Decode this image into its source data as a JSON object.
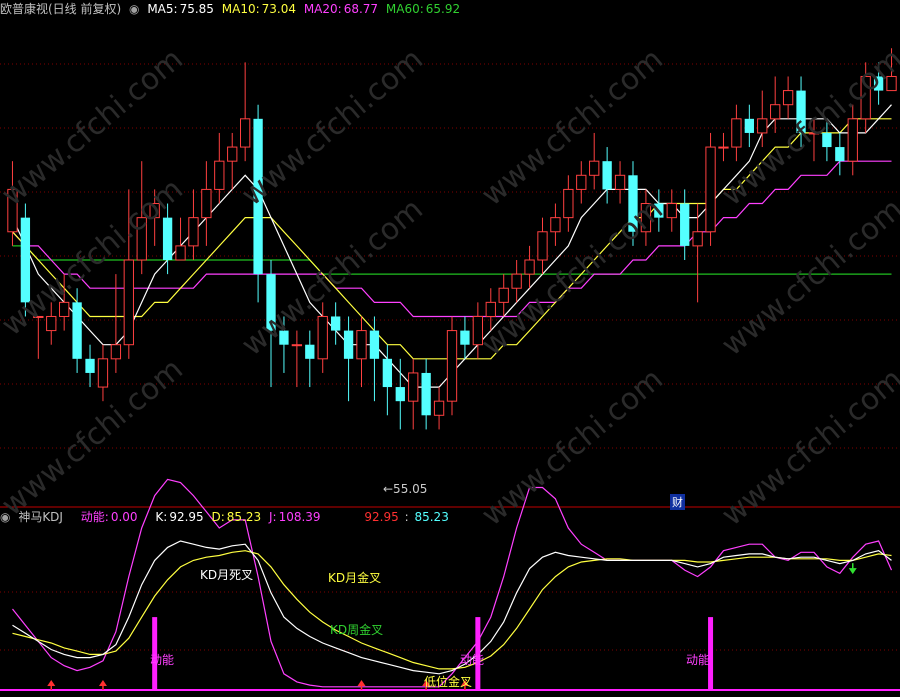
{
  "top_header": {
    "title": "欧普康视(日线 前复权)",
    "ma5_label": "MA5:",
    "ma5_value": "75.85",
    "ma10_label": "MA10:",
    "ma10_value": "73.04",
    "ma20_label": "MA20:",
    "ma20_value": "68.77",
    "ma60_label": "MA60:",
    "ma60_value": "65.92"
  },
  "bottom_header": {
    "title": "神马KDJ",
    "dn_label": "动能:",
    "dn_value": "0.00",
    "k_label": "K:",
    "k_value": "92.95",
    "d_label": "D:",
    "d_value": "85.23",
    "j_label": "J:",
    "j_value": "108.39",
    "v1": "92.95",
    "v2": "85.23"
  },
  "low_marker": "←55.05",
  "cai_badge": "财",
  "annotations": {
    "kd_month_dead": "KD月死叉",
    "kd_month_gold": "KD月金叉",
    "kd_week_gold": "KD周金叉",
    "low_gold": "低位金叉",
    "dongneng1": "动能",
    "dongneng2": "动能",
    "dongneng3": "动能"
  },
  "watermark": "www.cfchi.com",
  "colors": {
    "up": "#ff4040",
    "down": "#54ffff",
    "ma5": "#ffffff",
    "ma10": "#ffff40",
    "ma20": "#ff40ff",
    "ma60": "#20c020",
    "grid": "#800000"
  },
  "chart_data": {
    "type": "candlestick",
    "price_ylim": [
      50,
      84
    ],
    "candles": [
      [
        69,
        72,
        74,
        68
      ],
      [
        70,
        64,
        71,
        63
      ],
      [
        63,
        63,
        63,
        60
      ],
      [
        62,
        63,
        64,
        61
      ],
      [
        63,
        64,
        66,
        62
      ],
      [
        64,
        60,
        65,
        59
      ],
      [
        60,
        59,
        61,
        58
      ],
      [
        58,
        60,
        61,
        57
      ],
      [
        60,
        61,
        66,
        59
      ],
      [
        61,
        67,
        72,
        60
      ],
      [
        67,
        70,
        74,
        66
      ],
      [
        70,
        71,
        72,
        68
      ],
      [
        70,
        67,
        71,
        66
      ],
      [
        67,
        68,
        70,
        67
      ],
      [
        68,
        70,
        72,
        67
      ],
      [
        70,
        72,
        74,
        68
      ],
      [
        72,
        74,
        76,
        71
      ],
      [
        74,
        75,
        76,
        72
      ],
      [
        75,
        77,
        81,
        74
      ],
      [
        77,
        66,
        78,
        64
      ],
      [
        66,
        62,
        67,
        58
      ],
      [
        62,
        61,
        63,
        59
      ],
      [
        61,
        61,
        62,
        58
      ],
      [
        61,
        60,
        62,
        58
      ],
      [
        60,
        63,
        64,
        59
      ],
      [
        63,
        62,
        64,
        61
      ],
      [
        62,
        60,
        63,
        57
      ],
      [
        60,
        62,
        63,
        58
      ],
      [
        62,
        60,
        63,
        57
      ],
      [
        60,
        58,
        61,
        56
      ],
      [
        58,
        57,
        60,
        55
      ],
      [
        57,
        59,
        60,
        55
      ],
      [
        59,
        56,
        60,
        55
      ],
      [
        56,
        57,
        58,
        55
      ],
      [
        57,
        62,
        63,
        56
      ],
      [
        62,
        61,
        63,
        60
      ],
      [
        61,
        63,
        64,
        60
      ],
      [
        63,
        64,
        65,
        62
      ],
      [
        64,
        65,
        66,
        63
      ],
      [
        65,
        66,
        67,
        64
      ],
      [
        66,
        67,
        68,
        65
      ],
      [
        67,
        69,
        70,
        66
      ],
      [
        69,
        70,
        71,
        68
      ],
      [
        70,
        72,
        73,
        69
      ],
      [
        72,
        73,
        74,
        71
      ],
      [
        73,
        74,
        76,
        72
      ],
      [
        74,
        72,
        75,
        71
      ],
      [
        72,
        73,
        74,
        71
      ],
      [
        73,
        69,
        74,
        68
      ],
      [
        69,
        71,
        72,
        68
      ],
      [
        71,
        70,
        72,
        69
      ],
      [
        70,
        71,
        72,
        69
      ],
      [
        71,
        68,
        72,
        67
      ],
      [
        68,
        69,
        71,
        64
      ],
      [
        69,
        75,
        76,
        68
      ],
      [
        75,
        75,
        76,
        74
      ],
      [
        75,
        77,
        78,
        74
      ],
      [
        77,
        76,
        78,
        75
      ],
      [
        76,
        77,
        79,
        75
      ],
      [
        77,
        78,
        80,
        76
      ],
      [
        78,
        79,
        80,
        77
      ],
      [
        79,
        76,
        80,
        75
      ],
      [
        76,
        76,
        77,
        74
      ],
      [
        76,
        75,
        77,
        74
      ],
      [
        75,
        74,
        76,
        73
      ],
      [
        74,
        77,
        78,
        73
      ],
      [
        77,
        80,
        81,
        76
      ],
      [
        80,
        79,
        81,
        78
      ],
      [
        79,
        80,
        82,
        79
      ]
    ],
    "ma5": [
      70,
      68,
      66,
      65,
      64,
      63,
      62,
      61,
      61,
      62,
      64,
      66,
      67,
      68,
      69,
      70,
      71,
      72,
      73,
      72,
      70,
      68,
      66,
      64,
      63,
      62,
      61,
      61,
      61,
      60,
      59,
      58,
      58,
      58,
      59,
      60,
      61,
      62,
      63,
      64,
      65,
      66,
      67,
      68,
      70,
      71,
      72,
      72,
      72,
      72,
      71,
      71,
      70,
      70,
      71,
      72,
      73,
      74,
      76,
      77,
      77,
      77,
      77,
      77,
      76,
      76,
      76,
      77,
      78
    ],
    "ma10": [
      69,
      68,
      67,
      66,
      65,
      64,
      63,
      63,
      63,
      63,
      63,
      64,
      64,
      65,
      66,
      67,
      68,
      69,
      70,
      70,
      70,
      69,
      68,
      67,
      66,
      65,
      64,
      63,
      62,
      61,
      61,
      60,
      60,
      60,
      60,
      60,
      60,
      60,
      61,
      61,
      62,
      63,
      64,
      65,
      66,
      67,
      68,
      69,
      70,
      70,
      71,
      71,
      71,
      71,
      71,
      72,
      72,
      73,
      74,
      75,
      75,
      76,
      76,
      76,
      76,
      77,
      77,
      77,
      77
    ],
    "ma20": [
      69,
      68,
      68,
      67,
      66,
      66,
      65,
      65,
      65,
      65,
      65,
      65,
      65,
      65,
      65,
      66,
      66,
      66,
      66,
      66,
      66,
      66,
      66,
      66,
      66,
      65,
      65,
      65,
      64,
      64,
      64,
      63,
      63,
      63,
      63,
      63,
      63,
      63,
      63,
      63,
      64,
      64,
      64,
      65,
      65,
      66,
      66,
      66,
      67,
      67,
      68,
      68,
      68,
      69,
      69,
      70,
      70,
      71,
      71,
      72,
      72,
      73,
      73,
      73,
      74,
      74,
      74,
      74,
      74
    ],
    "ma60": [
      68,
      68,
      67,
      67,
      67,
      67,
      67,
      67,
      67,
      67,
      67,
      67,
      67,
      67,
      67,
      67,
      67,
      67,
      67,
      67,
      67,
      67,
      67,
      67,
      66,
      66,
      66,
      66,
      66,
      66,
      66,
      66,
      66,
      66,
      66,
      66,
      66,
      66,
      66,
      66,
      66,
      66,
      66,
      66,
      66,
      66,
      66,
      66,
      66,
      66,
      66,
      66,
      66,
      66,
      66,
      66,
      66,
      66,
      66,
      66,
      66,
      66,
      66,
      66,
      66,
      66,
      66,
      66,
      66
    ],
    "kdj_ylim": [
      0,
      100
    ],
    "K": [
      40,
      35,
      30,
      25,
      22,
      20,
      20,
      22,
      28,
      45,
      65,
      80,
      88,
      92,
      90,
      88,
      87,
      89,
      90,
      80,
      60,
      45,
      38,
      33,
      29,
      26,
      23,
      20,
      18,
      16,
      14,
      12,
      11,
      10,
      12,
      16,
      22,
      30,
      42,
      60,
      75,
      82,
      85,
      83,
      82,
      81,
      80,
      80,
      80,
      80,
      80,
      80,
      78,
      76,
      78,
      82,
      83,
      84,
      84,
      82,
      81,
      82,
      82,
      80,
      78,
      80,
      84,
      86,
      80
    ],
    "D": [
      35,
      33,
      31,
      29,
      26,
      24,
      22,
      22,
      24,
      32,
      45,
      58,
      68,
      76,
      80,
      82,
      83,
      85,
      86,
      84,
      76,
      65,
      56,
      48,
      42,
      37,
      33,
      29,
      26,
      23,
      20,
      17,
      15,
      13,
      13,
      14,
      17,
      21,
      28,
      38,
      50,
      62,
      70,
      76,
      79,
      80,
      81,
      81,
      80,
      80,
      80,
      80,
      80,
      79,
      79,
      80,
      81,
      82,
      82,
      82,
      81,
      81,
      81,
      81,
      80,
      80,
      82,
      84,
      83
    ],
    "J": [
      50,
      40,
      30,
      20,
      15,
      12,
      14,
      18,
      36,
      70,
      100,
      120,
      130,
      128,
      120,
      110,
      100,
      105,
      105,
      70,
      30,
      10,
      5,
      3,
      2,
      2,
      2,
      2,
      2,
      2,
      2,
      2,
      2,
      2,
      10,
      20,
      30,
      45,
      70,
      100,
      125,
      125,
      118,
      100,
      90,
      85,
      80,
      80,
      80,
      80,
      80,
      80,
      74,
      70,
      76,
      86,
      88,
      90,
      90,
      82,
      80,
      85,
      85,
      76,
      72,
      82,
      90,
      92,
      74
    ],
    "dongneng_bars": [
      11,
      36,
      54
    ],
    "up_arrows": [
      3,
      7,
      27,
      32,
      35
    ],
    "down_arrows": [
      65
    ]
  }
}
